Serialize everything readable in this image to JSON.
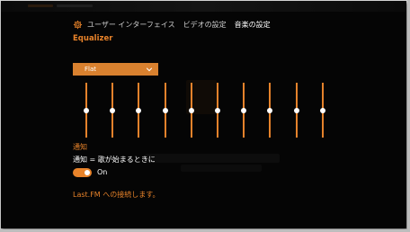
{
  "nav": {
    "tabs": [
      {
        "label": "ユーザー インターフェイス",
        "active": false
      },
      {
        "label": "ビデオの設定",
        "active": false
      },
      {
        "label": "音楽の設定",
        "active": true
      }
    ],
    "icon": "gear-icon"
  },
  "equalizer": {
    "title": "Equalizer",
    "preset": "Flat",
    "band_count": 10,
    "band_levels": [
      0,
      0,
      0,
      0,
      0,
      0,
      0,
      0,
      0,
      0
    ]
  },
  "notifications": {
    "title": "通知",
    "description": "通知 = 歌が始まるときに",
    "toggle_label": "On",
    "toggle_on": true
  },
  "lastfm": {
    "link_text": "Last.FM への接続します。"
  },
  "colors": {
    "accent": "#e8832a",
    "background": "#050505",
    "text": "#ffffff"
  }
}
